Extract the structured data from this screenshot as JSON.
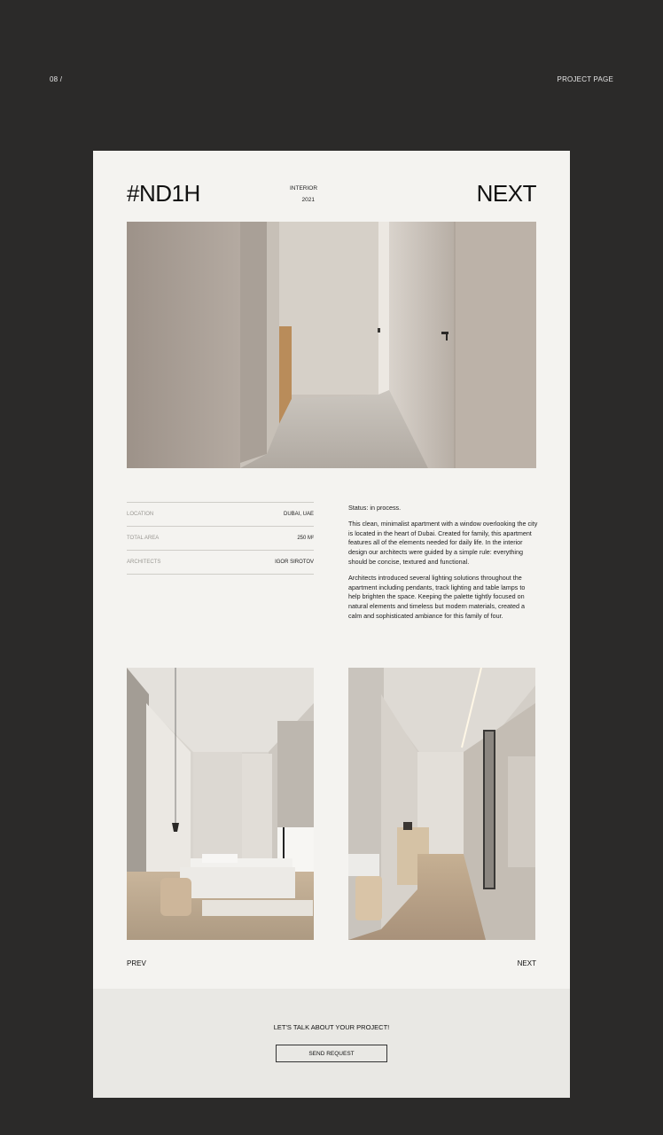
{
  "page": {
    "index": "08 /",
    "label": "PROJECT PAGE"
  },
  "header": {
    "title": "#ND1H",
    "category": "INTERIOR",
    "year": "2021",
    "next_label": "NEXT"
  },
  "specs": [
    {
      "label": "LOCATION",
      "value": "DUBAI, UAE"
    },
    {
      "label": "TOTAL AREA",
      "value": "250 M²"
    },
    {
      "label": "ARCHITECTS",
      "value": "IGOR SIROTOV"
    }
  ],
  "description": {
    "status": "Status: in process.",
    "paragraph1": "This clean, minimalist apartment with a window overlooking the city is located in the heart of Dubai. Created for family, this apartment features all of the elements needed for daily life. In the interior design our architects were guided by a simple rule: everything should be concise, textured and functional.",
    "paragraph2": "Architects introduced several lighting solutions throughout the apartment including pendants, track lighting and table lamps to help brighten the space. Keeping the palette tightly focused on natural elements and  timeless but modern materials, created a calm and sophisticated ambiance for this family of four."
  },
  "navigation": {
    "prev": "PREV",
    "next": "NEXT"
  },
  "footer": {
    "cta": "LET'S TALK ABOUT YOUR PROJECT!",
    "button": "SEND REQUEST"
  },
  "colors": {
    "background": "#2b2a29",
    "card": "#f4f3f0",
    "footer": "#e9e8e4"
  }
}
